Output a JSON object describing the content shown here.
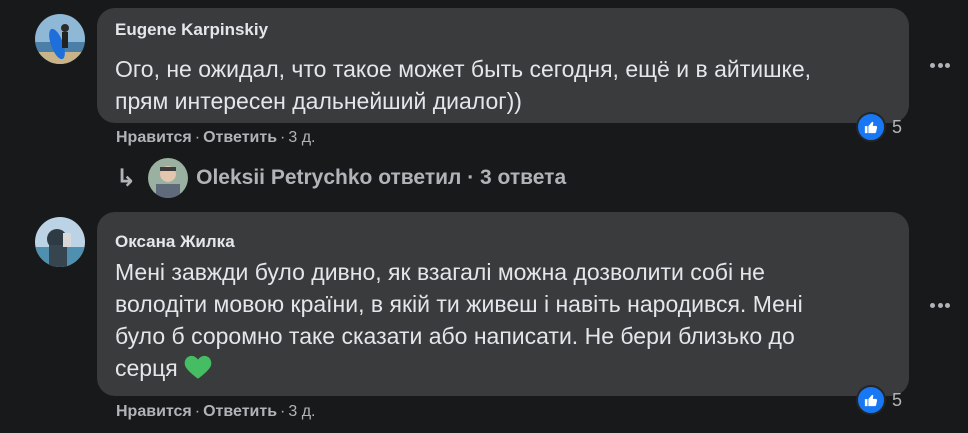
{
  "comments": [
    {
      "author": "Eugene Karpinskiy",
      "text_line1": "Ого, не ожидал, что такое может быть сегодня, ещё и в айтишке,",
      "text_line2": "прям интересен дальнейший диалог))",
      "like_label": "Нравится",
      "reply_label": "Ответить",
      "time": "3 д.",
      "reactions": "5"
    },
    {
      "author": "Оксана Жилка",
      "text_line1": "Мені завжди було дивно, як взагалі можна дозволити собі не",
      "text_line2": "володіти мовою країни, в якій ти живеш і навіть народився. Мені",
      "text_line3": "було б соромно таке сказати або написати. Не бери близько до",
      "text_line4": "серця",
      "like_label": "Нравится",
      "reply_label": "Ответить",
      "time": "3 д.",
      "reactions": "5"
    }
  ],
  "replies_link": {
    "text": "Oleksii Petrychko ответил · 3 ответа"
  },
  "colors": {
    "background": "#18191a",
    "bubble": "#3a3b3c",
    "like_blue": "#1877f2",
    "heart_green": "#45bd62"
  },
  "icons": [
    "avatar",
    "like-icon",
    "reply-arrow-icon",
    "more-options-icon",
    "green-heart-icon"
  ]
}
